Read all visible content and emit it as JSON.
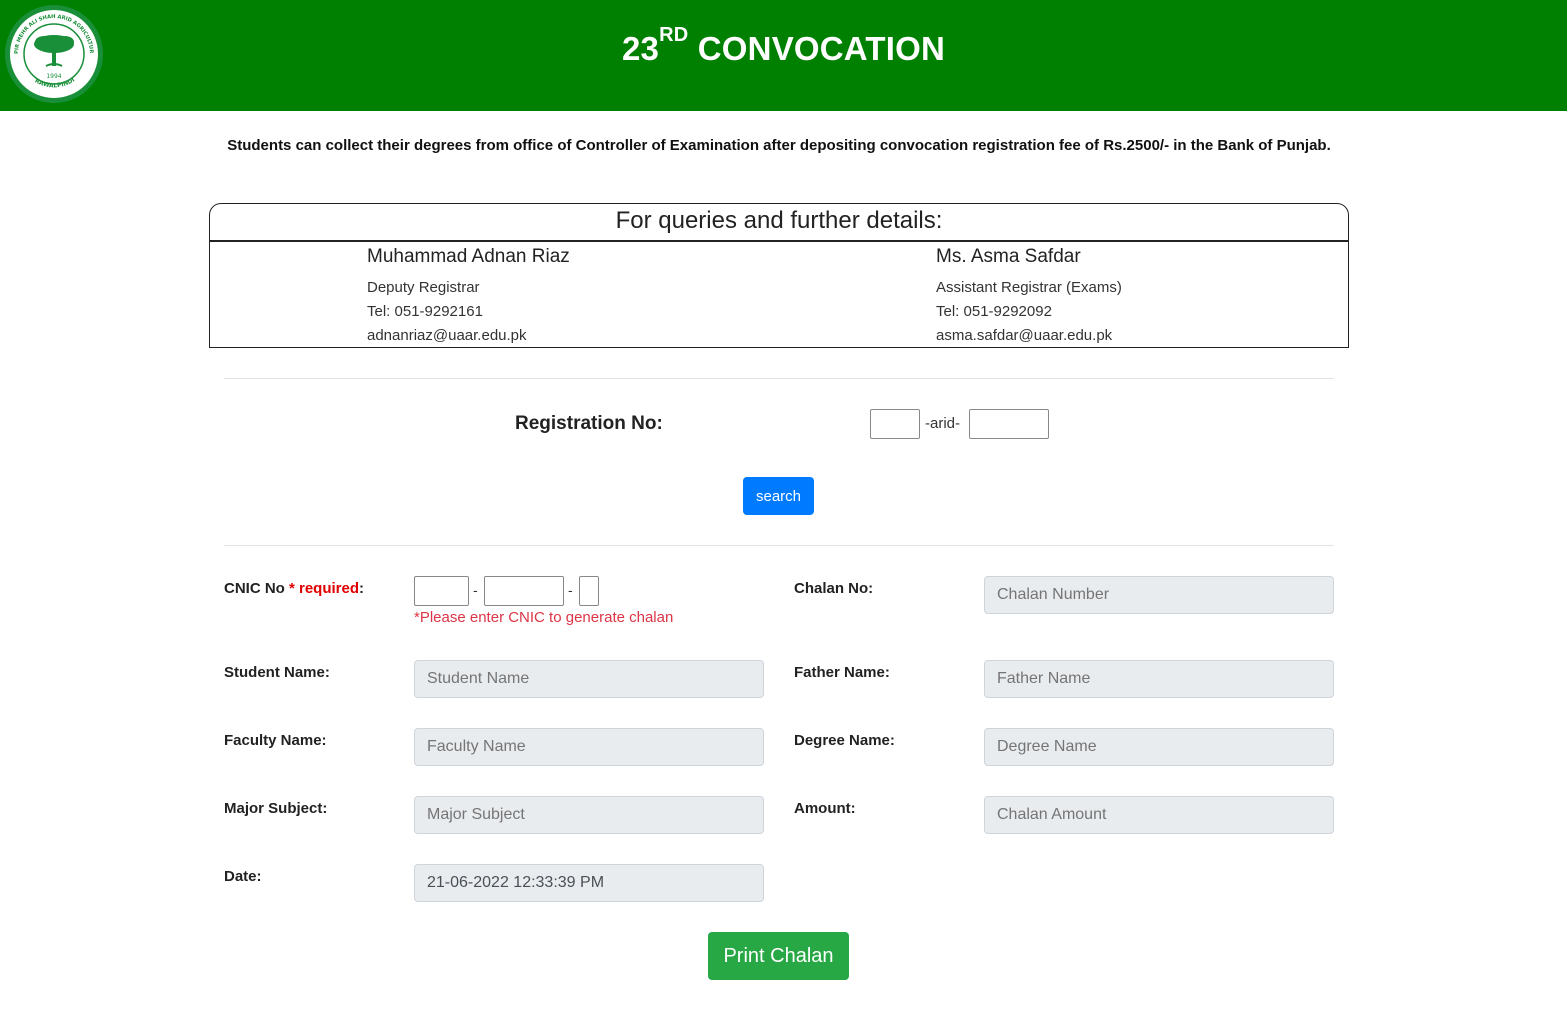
{
  "header": {
    "title_prefix": "23",
    "title_suffix_sup": "RD",
    "title_rest": " CONVOCATION",
    "logo": {
      "icon": "university-seal-icon",
      "year": "1994",
      "ring_text": "PIR MEHR ALI SHAH ARID AGRICULTURE UNIVERSITY",
      "city": "RAWALPINDI"
    },
    "bg_color": "#008000"
  },
  "notice": "Students can collect their degrees from office of Controller of Examination after depositing convocation registration fee of Rs.2500/- in the Bank of Punjab.",
  "contacts": {
    "heading": "For queries and further details:",
    "people": [
      {
        "name": "Muhammad Adnan Riaz",
        "role": "Deputy Registrar",
        "tel": "Tel: 051-9292161",
        "email": "adnanriaz@uaar.edu.pk"
      },
      {
        "name": "Ms. Asma Safdar",
        "role": "Assistant Registrar (Exams)",
        "tel": "Tel: 051-9292092",
        "email": "asma.safdar@uaar.edu.pk"
      }
    ]
  },
  "registration": {
    "label": "Registration No:",
    "separator": "-arid-",
    "part1_value": "",
    "part2_value": "",
    "search_label": "search"
  },
  "form": {
    "cnic": {
      "label": "CNIC No",
      "required_text": "* required",
      "colon": ":",
      "dash": "-",
      "hint": "*Please enter CNIC to generate chalan"
    },
    "chalan_no": {
      "label": "Chalan No:",
      "placeholder": "Chalan Number"
    },
    "student_name": {
      "label": "Student Name:",
      "placeholder": "Student Name"
    },
    "father_name": {
      "label": "Father Name:",
      "placeholder": "Father Name"
    },
    "faculty_name": {
      "label": "Faculty Name:",
      "placeholder": "Faculty Name"
    },
    "degree_name": {
      "label": "Degree Name:",
      "placeholder": "Degree Name"
    },
    "major_subject": {
      "label": "Major Subject:",
      "placeholder": "Major Subject"
    },
    "amount": {
      "label": "Amount:",
      "placeholder": "Chalan Amount"
    },
    "date": {
      "label": "Date:",
      "value": "21-06-2022 12:33:39 PM"
    },
    "print_label": "Print Chalan"
  },
  "colors": {
    "primary_button": "#007bff",
    "success_button": "#28a745",
    "required": "#e00000",
    "readonly_field": "#e9ecef"
  }
}
